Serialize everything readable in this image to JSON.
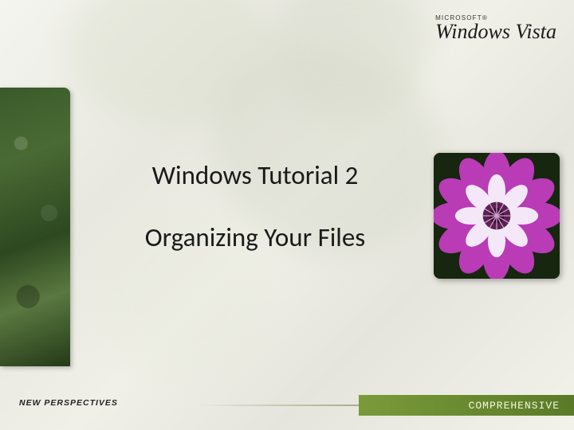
{
  "branding": {
    "small": "MICROSOFT®",
    "main": "Windows Vista"
  },
  "titles": {
    "line1": "Windows Tutorial 2",
    "line2": "Organizing Your Files"
  },
  "bottom_left": "NEW PERSPECTIVES",
  "footer": "COMPREHENSIVE"
}
